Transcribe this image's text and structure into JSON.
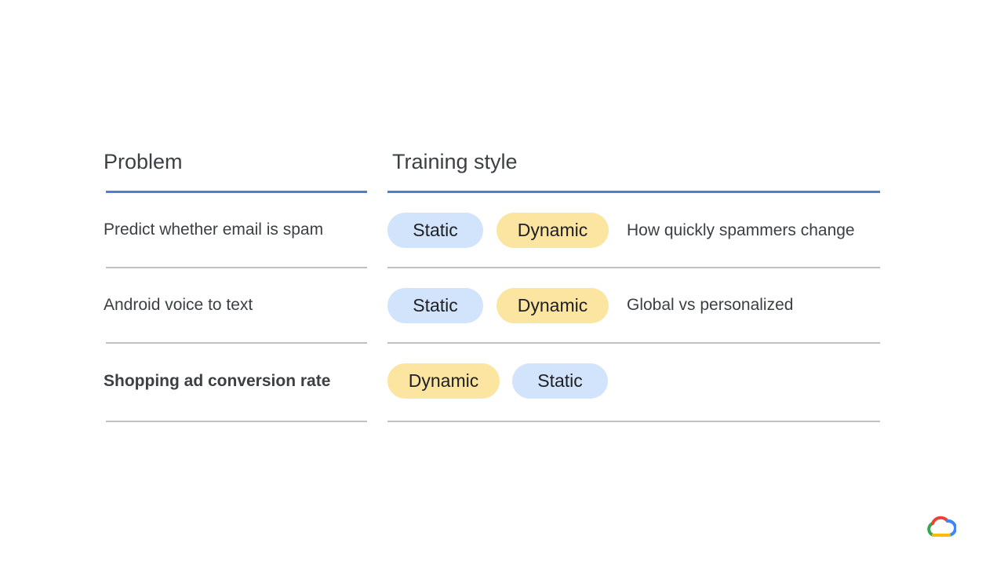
{
  "headers": {
    "problem": "Problem",
    "training_style": "Training style"
  },
  "rows": [
    {
      "problem": "Predict whether email is spam",
      "pills": [
        "Static",
        "Dynamic"
      ],
      "note": "How quickly spammers change"
    },
    {
      "problem": "Android voice to text",
      "pills": [
        "Static",
        "Dynamic"
      ],
      "note": "Global vs personalized"
    },
    {
      "problem": "Shopping ad conversion rate",
      "pills": [
        "Dynamic",
        "Static"
      ],
      "note": ""
    }
  ],
  "colors": {
    "accent_rule": "#4a7fd4",
    "static_pill": "#d2e3fc",
    "dynamic_pill": "#fbe5a0"
  },
  "logo_icon": "google-cloud-logo-icon"
}
